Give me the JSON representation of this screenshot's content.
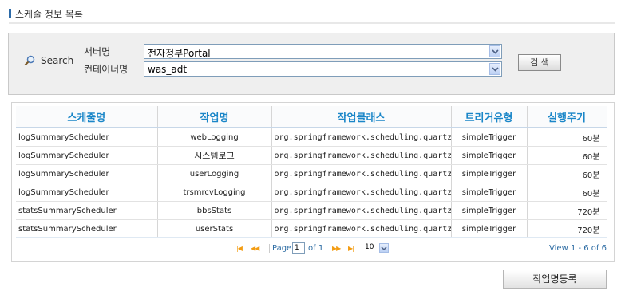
{
  "page": {
    "title": "스케줄 정보 목록"
  },
  "search": {
    "label": "Search",
    "server_label": "서버명",
    "server_value": "전자정부Portal",
    "container_label": "컨테이너명",
    "container_value": "was_adt",
    "button_label": "검 색"
  },
  "grid": {
    "columns": [
      "스케줄명",
      "작업명",
      "작업클래스",
      "트리거유형",
      "실행주기"
    ],
    "rows": [
      [
        "logSummaryScheduler",
        "webLogging",
        "org.springframework.scheduling.quartz.Met",
        "simpleTrigger",
        "60분"
      ],
      [
        "logSummaryScheduler",
        "시스템로그",
        "org.springframework.scheduling.quartz.Met",
        "simpleTrigger",
        "60분"
      ],
      [
        "logSummaryScheduler",
        "userLogging",
        "org.springframework.scheduling.quartz.Met",
        "simpleTrigger",
        "60분"
      ],
      [
        "logSummaryScheduler",
        "trsmrcvLogging",
        "org.springframework.scheduling.quartz.Met",
        "simpleTrigger",
        "60분"
      ],
      [
        "statsSummaryScheduler",
        "bbsStats",
        "org.springframework.scheduling.quartz.Met",
        "simpleTrigger",
        "720분"
      ],
      [
        "statsSummaryScheduler",
        "userStats",
        "org.springframework.scheduling.quartz.Met",
        "simpleTrigger",
        "720분"
      ]
    ]
  },
  "pager": {
    "page_label": "Page",
    "page_value": "1",
    "of_label": "of 1",
    "rows_per_page": "10",
    "view_text": "View 1 - 6 of 6",
    "first_icon": "first-page-icon",
    "prev_icon": "prev-page-icon",
    "next_icon": "next-page-icon",
    "last_icon": "last-page-icon"
  },
  "actions": {
    "register_label": "작업명등록"
  },
  "colors": {
    "accent": "#2c6aa8",
    "header_text": "#1a86c8",
    "pager_icon": "#f39c12"
  }
}
